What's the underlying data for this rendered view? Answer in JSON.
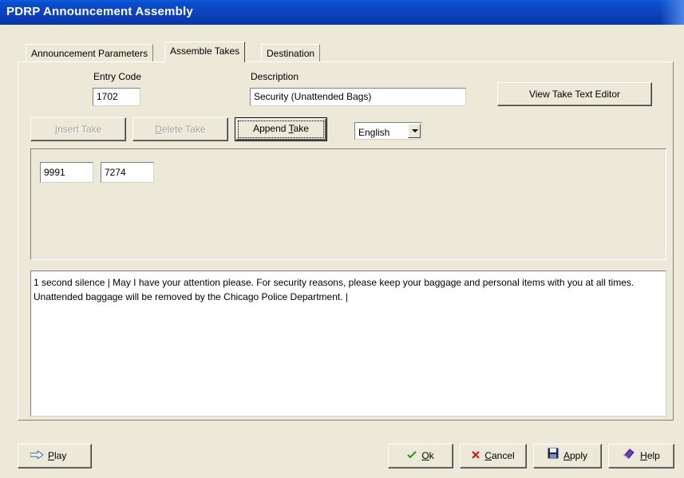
{
  "window": {
    "title": "PDRP Announcement Assembly"
  },
  "tabs": [
    {
      "label": "Announcement Parameters",
      "active": false
    },
    {
      "label": "Assemble Takes",
      "active": true
    },
    {
      "label": "Destination",
      "active": false
    }
  ],
  "entry_code": {
    "label": "Entry Code",
    "value": "1702"
  },
  "description": {
    "label": "Description",
    "value": "Security (Unattended Bags)"
  },
  "buttons": {
    "view_take_text_editor": "View Take Text Editor",
    "insert_take": {
      "pre": "",
      "key": "I",
      "post": "nsert Take",
      "enabled": false
    },
    "delete_take": {
      "pre": "",
      "key": "D",
      "post": "elete Take",
      "enabled": false
    },
    "append_take": {
      "pre": "Append ",
      "key": "T",
      "post": "ake",
      "enabled": true
    }
  },
  "language": {
    "selected": "English"
  },
  "takes": [
    "9991",
    "7274"
  ],
  "take_text": "1 second silence  |  May I have your attention please. For security reasons, please keep your baggage and personal items with you at all times. Unattended baggage will be removed by the Chicago Police Department.  |",
  "footer": {
    "play": {
      "key": "P",
      "post": "lay",
      "icon": "arrow-right-icon"
    },
    "ok": {
      "key": "O",
      "post": "k",
      "icon": "checkmark-icon"
    },
    "cancel": {
      "key": "C",
      "post": "ancel",
      "icon": "x-icon"
    },
    "apply": {
      "key": "A",
      "post": "pply",
      "icon": "floppy-disk-icon"
    },
    "help": {
      "key": "H",
      "post": "elp",
      "icon": "help-book-icon"
    }
  },
  "colors": {
    "titlebar": "#0a4fd0",
    "face": "#ece9d8",
    "check": "#2e8b2e",
    "cancel": "#cc1111"
  }
}
